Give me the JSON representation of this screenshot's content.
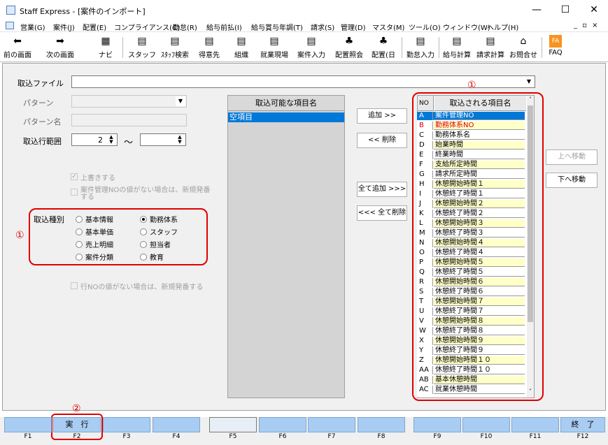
{
  "window": {
    "title": "Staff Express - [案件のインポート]",
    "minimize": "—",
    "maximize": "☐",
    "close": "✕"
  },
  "menu": {
    "items": [
      "営業(G)",
      "案件(J)",
      "配置(E)",
      "コンプライアンス(C)",
      "勤怠(R)",
      "給与前払(I)",
      "給与賞与年調(T)",
      "請求(S)",
      "管理(D)",
      "マスタ(M)",
      "ツール(O)",
      "ウィンドウ(W)",
      "ヘルプ(H)"
    ],
    "mdi_controls": "_ ▫ ×"
  },
  "toolbar": {
    "prev": "前の画面",
    "next": "次の画面",
    "navi": "ナビ",
    "buttons": [
      "スタッフ",
      "ｽﾀｯﾌ検索",
      "得意先",
      "組織",
      "就業現場",
      "案件入力",
      "配置照会",
      "配置(日",
      "勤怠入力",
      "給与計算",
      "請求計算",
      "お問合せ",
      "FAQ"
    ]
  },
  "form": {
    "file_label": "取込ファイル",
    "pattern_label": "パターン",
    "pattern_name_label": "パターン名",
    "range_label": "取込行範囲",
    "range_from": "2",
    "range_sep": "～",
    "range_to": "",
    "overwrite_label": "上書きする",
    "auto_number_label": "案件管理NOの値がない場合は、新規発番する",
    "row_no_label": "行NOの値がない場合は、新規発番する",
    "kind_label": "取込種別",
    "kinds": [
      "基本情報",
      "勤務体系",
      "基本単価",
      "スタッフ",
      "売上明細",
      "担当者",
      "案件分類",
      "教育"
    ],
    "kind_selected": "勤務体系"
  },
  "available": {
    "header": "取込可能な項目名",
    "items": [
      "空項目"
    ]
  },
  "actions": {
    "add": "追加 >>",
    "remove": "<< 削除",
    "add_all": "全て追加 >>>",
    "remove_all": "<<< 全て削除",
    "move_up": "上へ移動",
    "move_down": "下へ移動"
  },
  "imported": {
    "no_header": "NO",
    "name_header": "取込される項目名",
    "rows": [
      {
        "no": "A",
        "name": "案件管理NO",
        "style": "sel"
      },
      {
        "no": "B",
        "name": "勤務体系NO",
        "style": "red"
      },
      {
        "no": "C",
        "name": "勤務体系名",
        "style": "white"
      },
      {
        "no": "D",
        "name": "始業時間",
        "style": "yellow"
      },
      {
        "no": "E",
        "name": "終業時間",
        "style": "white"
      },
      {
        "no": "F",
        "name": "支給所定時間",
        "style": "yellow"
      },
      {
        "no": "G",
        "name": "請求所定時間",
        "style": "white"
      },
      {
        "no": "H",
        "name": "休憩開始時間１",
        "style": "yellow"
      },
      {
        "no": "I",
        "name": "休憩終了時間１",
        "style": "white"
      },
      {
        "no": "J",
        "name": "休憩開始時間２",
        "style": "yellow"
      },
      {
        "no": "K",
        "name": "休憩終了時間２",
        "style": "white"
      },
      {
        "no": "L",
        "name": "休憩開始時間３",
        "style": "yellow"
      },
      {
        "no": "M",
        "name": "休憩終了時間３",
        "style": "white"
      },
      {
        "no": "N",
        "name": "休憩開始時間４",
        "style": "yellow"
      },
      {
        "no": "O",
        "name": "休憩終了時間４",
        "style": "white"
      },
      {
        "no": "P",
        "name": "休憩開始時間５",
        "style": "yellow"
      },
      {
        "no": "Q",
        "name": "休憩終了時間５",
        "style": "white"
      },
      {
        "no": "R",
        "name": "休憩開始時間６",
        "style": "yellow"
      },
      {
        "no": "S",
        "name": "休憩終了時間６",
        "style": "white"
      },
      {
        "no": "T",
        "name": "休憩開始時間７",
        "style": "yellow"
      },
      {
        "no": "U",
        "name": "休憩終了時間７",
        "style": "white"
      },
      {
        "no": "V",
        "name": "休憩開始時間８",
        "style": "yellow"
      },
      {
        "no": "W",
        "name": "休憩終了時間８",
        "style": "white"
      },
      {
        "no": "X",
        "name": "休憩開始時間９",
        "style": "yellow"
      },
      {
        "no": "Y",
        "name": "休憩終了時間９",
        "style": "white"
      },
      {
        "no": "Z",
        "name": "休憩開始時間１０",
        "style": "yellow"
      },
      {
        "no": "AA",
        "name": "休憩終了時間１０",
        "style": "white"
      },
      {
        "no": "AB",
        "name": "基本休憩時間",
        "style": "yellow"
      },
      {
        "no": "AC",
        "name": "就業休憩時間",
        "style": "white"
      }
    ]
  },
  "annotations": {
    "one": "①",
    "two": "②"
  },
  "fkeys": {
    "labels": [
      "",
      "実　行",
      "",
      "",
      "",
      "",
      "",
      "",
      "",
      "",
      "",
      "終　了"
    ],
    "keys": [
      "F1",
      "F2",
      "F3",
      "F4",
      "F5",
      "F6",
      "F7",
      "F8",
      "F9",
      "F10",
      "F11",
      "F12"
    ]
  },
  "colors": {
    "selected": "#0078d7",
    "yellow": "#ffffc8",
    "red_text": "#e00000",
    "fkey": "#a9cdf2"
  }
}
